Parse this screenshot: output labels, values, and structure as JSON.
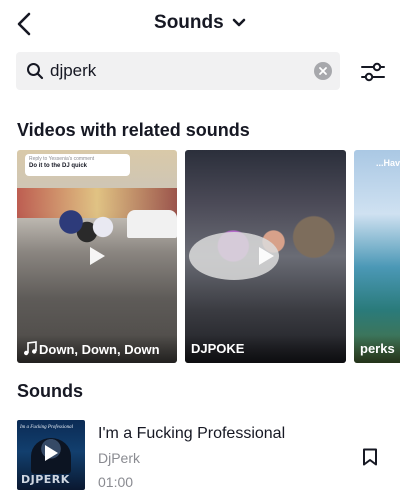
{
  "header": {
    "title": "Sounds",
    "back_icon": "back-arrow-icon",
    "dropdown_icon": "chevron-down-icon"
  },
  "search": {
    "value": "djperk",
    "placeholder": "",
    "search_icon": "search-icon",
    "clear_icon": "clear-icon",
    "filter_icon": "filter-sliders-icon"
  },
  "videos_section": {
    "title": "Videos with related sounds",
    "items": [
      {
        "label": "Down, Down, Down",
        "label_icon": "music-note-icon",
        "reply_line1": "Reply to Yessenia's comment",
        "reply_line2": "Do it to the DJ quick"
      },
      {
        "label": "DJPOKE"
      },
      {
        "label": "perks",
        "top_text": "...Hav"
      }
    ]
  },
  "sounds_section": {
    "title": "Sounds",
    "items": [
      {
        "cover_title": "Im a Fucking Professional",
        "cover_logo": "DJPERK",
        "name": "I'm a Fucking Professional",
        "artist": "DjPerk",
        "duration": "01:00",
        "bookmark_icon": "bookmark-icon"
      }
    ]
  },
  "colors": {
    "text_primary": "#161823",
    "text_secondary": "#8a8b91",
    "search_bg": "#f1f1f2",
    "background": "#ffffff"
  }
}
